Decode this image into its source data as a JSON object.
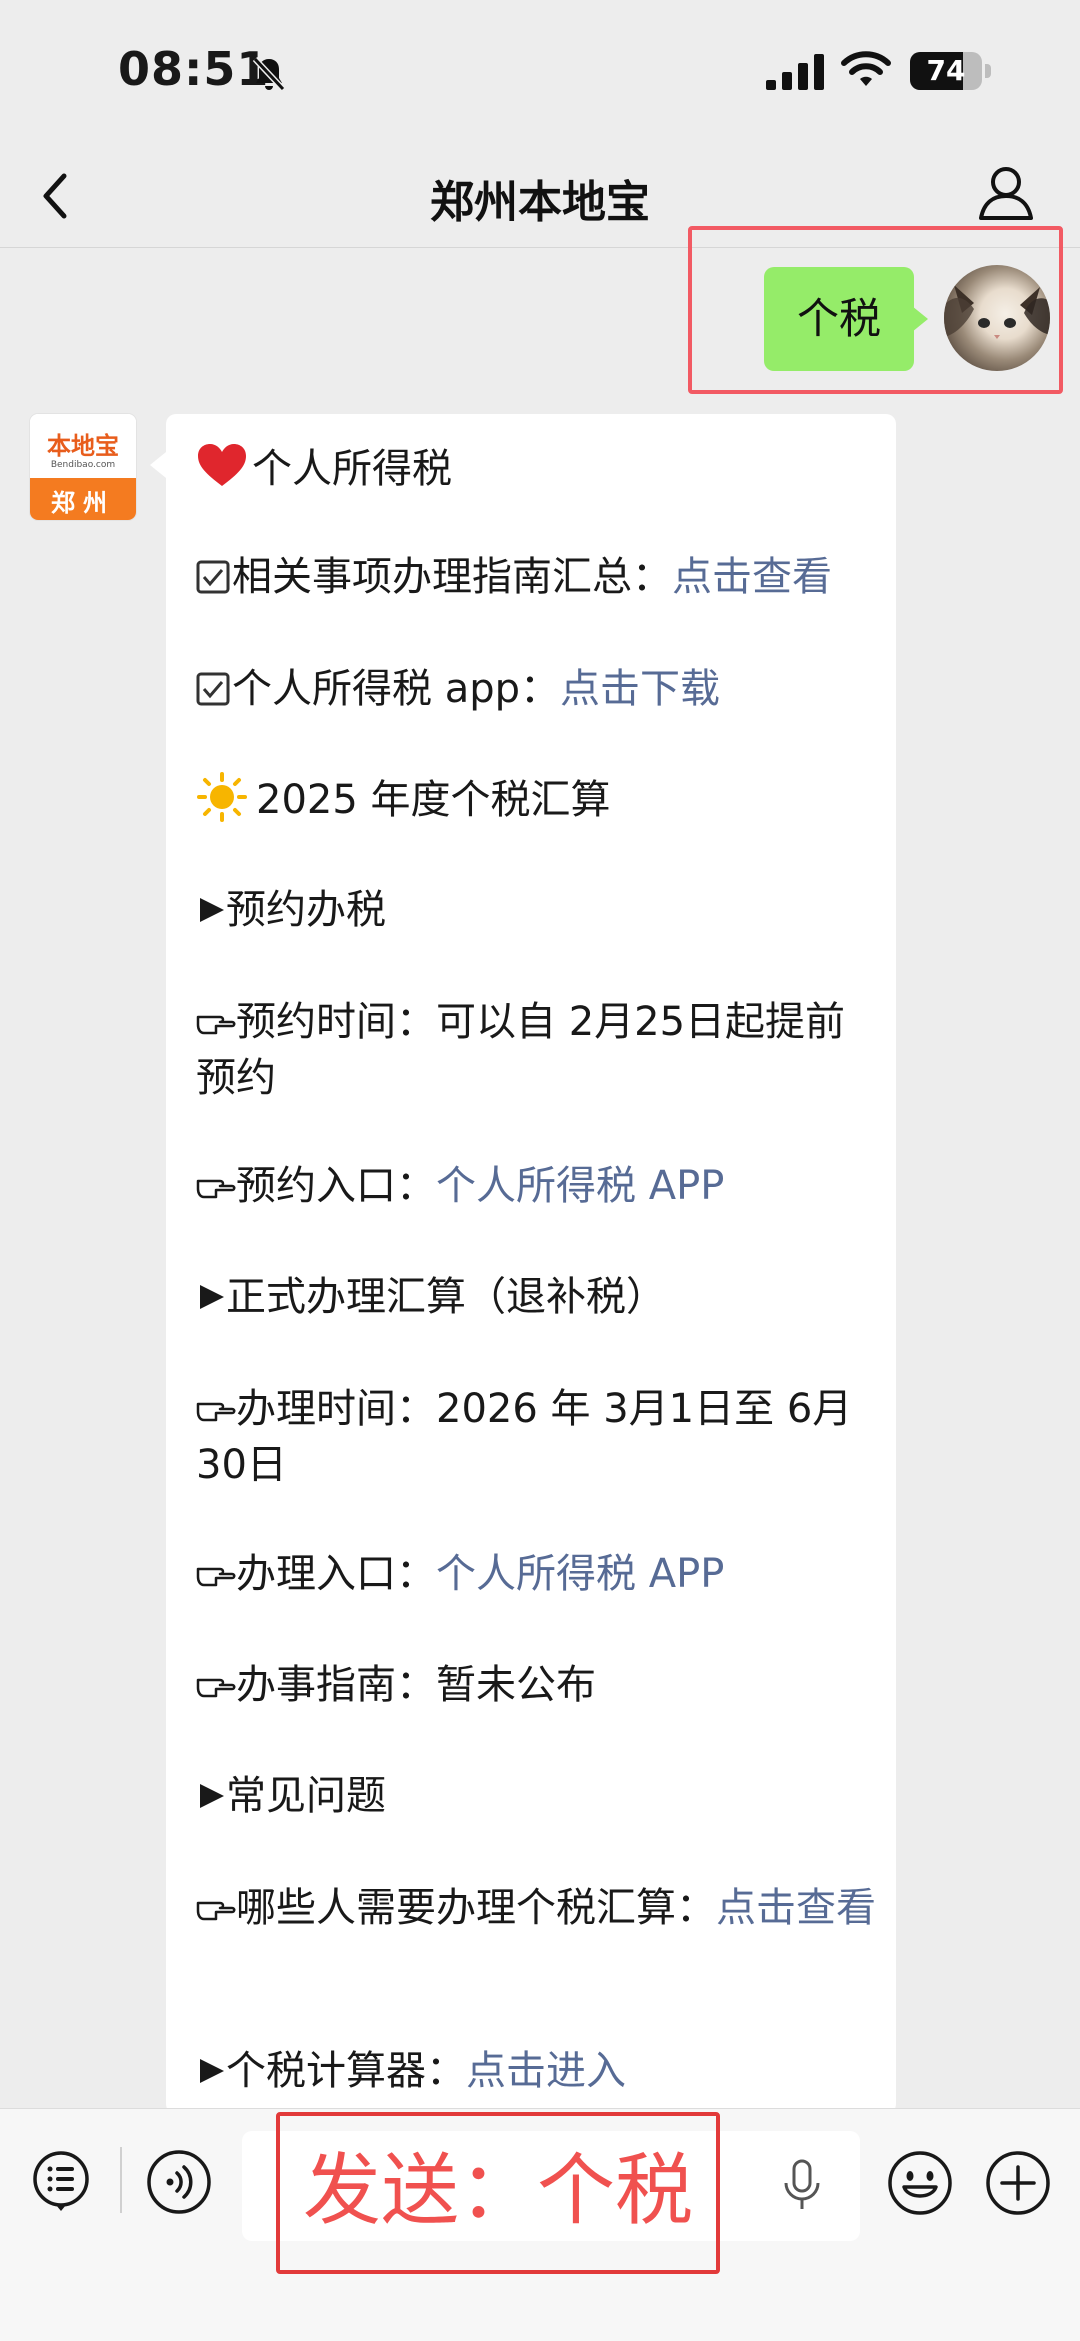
{
  "status_bar": {
    "time": "08:51",
    "battery_level": "74",
    "battery_fraction": 0.74
  },
  "nav": {
    "title": "郑州本地宝"
  },
  "outgoing_message": {
    "text": "个税"
  },
  "bot": {
    "logo_text": "本地宝",
    "logo_sub": "Bendibao.com",
    "city": "郑州"
  },
  "incoming_message": {
    "heading": "个人所得税",
    "guide_label": "相关事项办理指南汇总：",
    "guide_link": "点击查看",
    "app_label": "个人所得税 app：",
    "app_link": "点击下载",
    "year_heading": "2025 年度个税汇算",
    "appointment_heading": "预约办税",
    "appointment_time": "预约时间：可以自 2月25日起提前预约",
    "appointment_entry_label": "预约入口：",
    "appointment_entry_link": "个人所得税 APP",
    "formal_heading": "正式办理汇算（退补税）",
    "handle_time": "办理时间：2026 年 3月1日至 6月30日",
    "handle_entry_label": "办理入口：",
    "handle_entry_link": "个人所得税 APP",
    "guide_status": "办事指南：暂未公布",
    "faq_heading": "常见问题",
    "faq_label": "哪些人需要办理个税汇算：",
    "faq_link": "点击查看",
    "calculator_label": "个税计算器：",
    "calculator_link": "点击进入"
  },
  "overlay": {
    "send_hint": "发送：个税"
  },
  "colors": {
    "background": "#ededed",
    "outgoing_bubble": "#95ec69",
    "link": "#576b95",
    "highlight_border": "#f25a63",
    "send_hint": "#f0514f"
  },
  "icons": [
    "bell-slash-icon",
    "signal-icon",
    "wifi-icon",
    "battery-icon",
    "back-icon",
    "profile-icon",
    "heart-icon",
    "checkbox-icon",
    "sun-icon",
    "triangle-right-icon",
    "pointing-hand-icon",
    "menu-icon",
    "voice-icon",
    "mic-icon",
    "emoji-icon",
    "plus-icon"
  ]
}
